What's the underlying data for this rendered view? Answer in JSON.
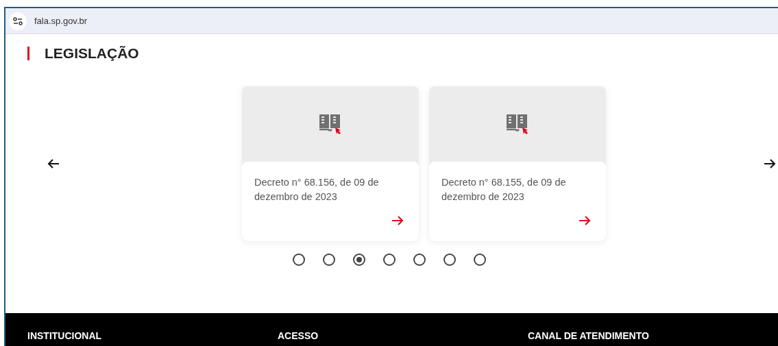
{
  "address_bar": {
    "url": "fala.sp.gov.br"
  },
  "section": {
    "title": "LEGISLAÇÃO"
  },
  "carousel": {
    "cards": [
      {
        "title": "Decreto n° 68.156, de 09 de dezembro de 2023"
      },
      {
        "title": "Decreto n° 68.155, de 09 de dezembro de 2023"
      }
    ],
    "dots": [
      {
        "selected": false
      },
      {
        "selected": false
      },
      {
        "selected": true
      },
      {
        "selected": false
      },
      {
        "selected": false
      },
      {
        "selected": false
      },
      {
        "selected": false
      }
    ]
  },
  "footer": {
    "headings": [
      "INSTITUCIONAL",
      "ACESSO",
      "CANAL DE ATENDIMENTO"
    ]
  }
}
